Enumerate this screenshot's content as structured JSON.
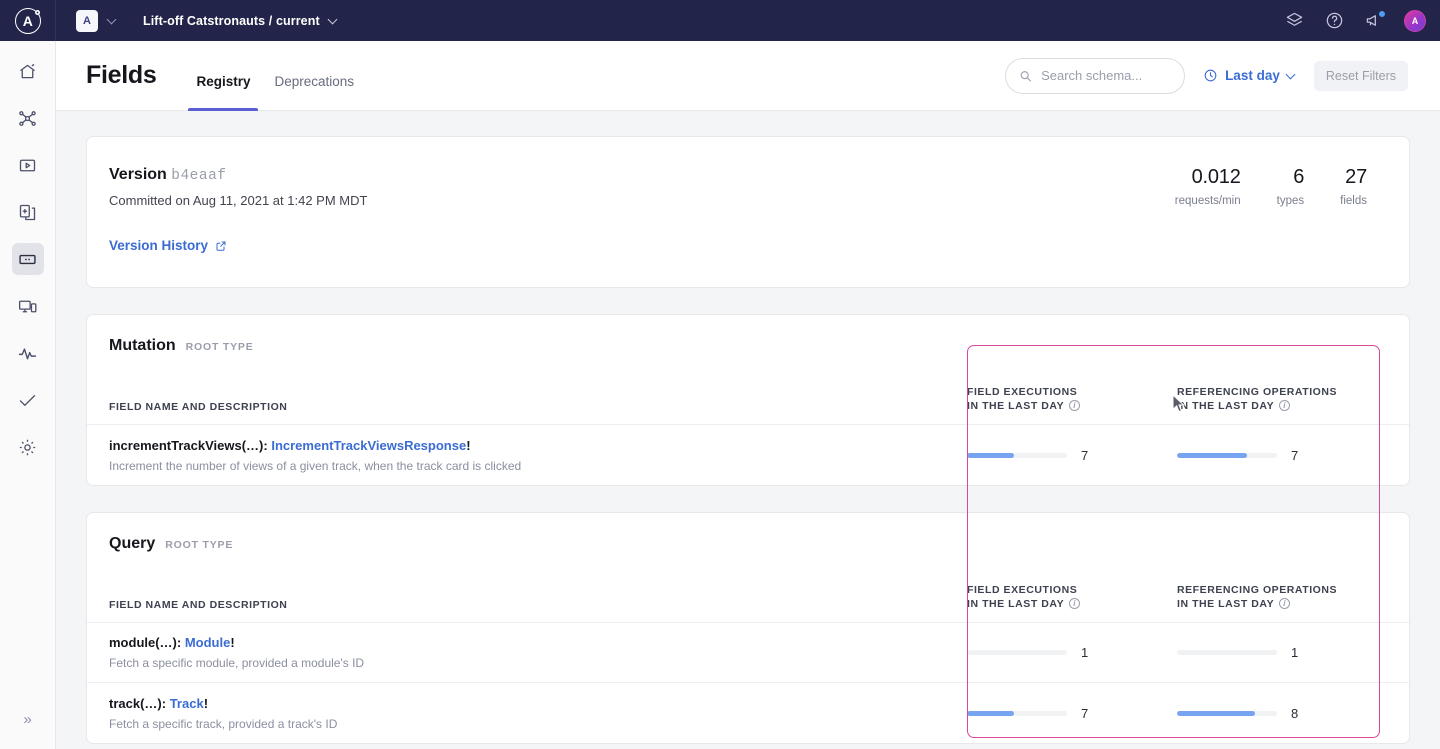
{
  "topbar": {
    "logo_letter": "A",
    "graph_badge": "A",
    "breadcrumb": "Lift-off Catstronauts / current",
    "icons": [
      "layers-icon",
      "help-circle-icon",
      "megaphone-icon"
    ],
    "avatar_letter": "A"
  },
  "sidebar": {
    "items": [
      {
        "name": "home",
        "label": "Home"
      },
      {
        "name": "graph",
        "label": "Graph"
      },
      {
        "name": "explorer",
        "label": "Explorer"
      },
      {
        "name": "schema",
        "label": "Schema"
      },
      {
        "name": "fields",
        "label": "Fields",
        "active": true
      },
      {
        "name": "clients",
        "label": "Clients"
      },
      {
        "name": "metrics",
        "label": "Metrics"
      },
      {
        "name": "checks",
        "label": "Checks"
      },
      {
        "name": "settings",
        "label": "Settings"
      }
    ],
    "expand_label": "»"
  },
  "header": {
    "title": "Fields",
    "tabs": [
      {
        "label": "Registry",
        "active": true
      },
      {
        "label": "Deprecations",
        "active": false
      }
    ],
    "search": {
      "placeholder": "Search schema...",
      "value": ""
    },
    "range": {
      "label": "Last day",
      "icon": "clock-icon"
    },
    "reset_label": "Reset Filters",
    "accent": "#5c5ed8"
  },
  "version_card": {
    "title": "Version",
    "hash": "b4eaaf",
    "committed": "Committed on Aug 11, 2021 at 1:42 PM MDT",
    "link_label": "Version History",
    "stats": [
      {
        "value": "0.012",
        "label": "requests/min"
      },
      {
        "value": "6",
        "label": "types"
      },
      {
        "value": "27",
        "label": "fields"
      }
    ]
  },
  "columns": {
    "field": "FIELD NAME AND DESCRIPTION",
    "executions_l1": "FIELD EXECUTIONS",
    "executions_l2": "IN THE LAST DAY",
    "referencing_l1": "REFERENCING OPERATIONS",
    "referencing_l2": "IN THE LAST DAY"
  },
  "sections": [
    {
      "type_name": "Mutation",
      "type_kind": "ROOT TYPE",
      "rows": [
        {
          "field": "incrementTrackViews(…):",
          "return_type": "IncrementTrackViewsResponse",
          "bang": "!",
          "description": "Increment the number of views of a given track, when the track card is clicked",
          "executions": "7",
          "executions_pct": 47,
          "referencing": "7",
          "referencing_pct": 70
        }
      ]
    },
    {
      "type_name": "Query",
      "type_kind": "ROOT TYPE",
      "rows": [
        {
          "field": "module(…):",
          "return_type": "Module",
          "bang": "!",
          "description": "Fetch a specific module, provided a module's ID",
          "executions": "1",
          "executions_pct": 0,
          "referencing": "1",
          "referencing_pct": 0
        },
        {
          "field": "track(…):",
          "return_type": "Track",
          "bang": "!",
          "description": "Fetch a specific track, provided a track's ID",
          "executions": "7",
          "executions_pct": 47,
          "referencing": "8",
          "referencing_pct": 78
        }
      ]
    }
  ],
  "highlight": {
    "color": "#d94a9e"
  }
}
